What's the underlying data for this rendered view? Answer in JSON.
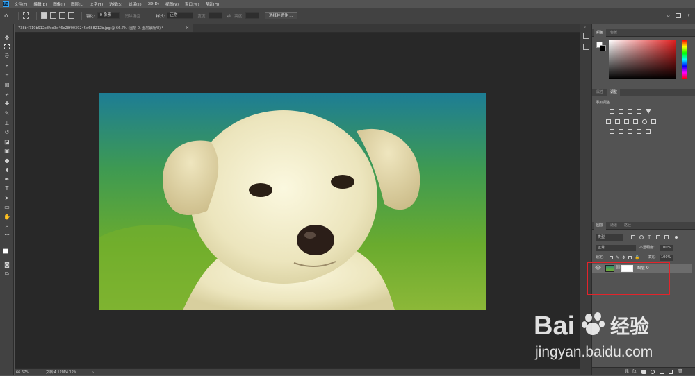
{
  "app": {
    "logo": "Ps"
  },
  "menu": [
    "文件(F)",
    "编辑(E)",
    "图像(I)",
    "图层(L)",
    "文字(Y)",
    "选择(S)",
    "滤镜(T)",
    "3D(D)",
    "视图(V)",
    "窗口(W)",
    "帮助(H)"
  ],
  "options": {
    "feather_label": "羽化:",
    "feather_value": "0 像素",
    "antialias_label": "消除锯齿",
    "style_label": "样式:",
    "style_value": "正常",
    "width_label": "宽度:",
    "height_label": "高度:",
    "select_mask_button": "选择并遮住 ..."
  },
  "document": {
    "tab_title": "738b4710b912c8fcd3d46e28f0039245d688212b.jpg @ 66.7% (图层 0, 图层蒙版/8) *",
    "close_glyph": "×"
  },
  "status": {
    "zoom": "66.67%",
    "doc_size": "文档:4.12M/4.12M"
  },
  "panels": {
    "color_tabs": [
      "颜色",
      "色板"
    ],
    "adjust_tabs": [
      "属性",
      "调整"
    ],
    "adjust_heading": "添加调整",
    "layers_tabs": [
      "图层",
      "通道",
      "路径"
    ],
    "filter_kind": "类型",
    "blend_mode": "正常",
    "opacity_label": "不透明度:",
    "opacity_value": "100%",
    "lock_label": "锁定:",
    "fill_label": "填充:",
    "fill_value": "100%",
    "layer_name": "图层 0"
  },
  "watermark": {
    "brand_left": "Bai",
    "brand_right": "百",
    "brand_cn": "经验",
    "url": "jingyan.baidu.com"
  },
  "colors": {
    "accent_highlight": "#e3242b",
    "ps_blue": "#31a8ff",
    "canvas_bg": "#282828"
  }
}
